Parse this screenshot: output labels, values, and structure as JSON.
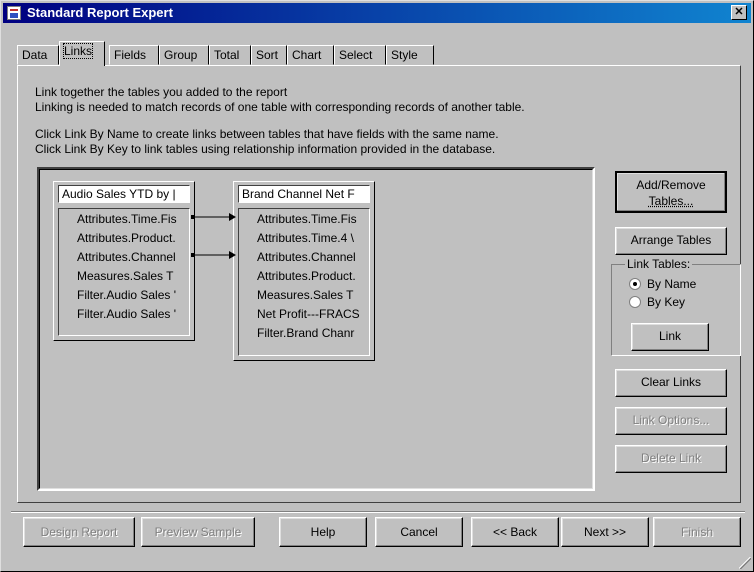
{
  "window": {
    "title": "Standard Report Expert",
    "close_label": "✕",
    "icon": "report-app-icon"
  },
  "tabs": [
    {
      "label": "Data"
    },
    {
      "label": "Links",
      "active": true
    },
    {
      "label": "Fields"
    },
    {
      "label": "Group"
    },
    {
      "label": "Total"
    },
    {
      "label": "Sort"
    },
    {
      "label": "Chart"
    },
    {
      "label": "Select"
    },
    {
      "label": "Style"
    }
  ],
  "instructions": {
    "line1": "Link together the tables you added to the report",
    "line2": "Linking is needed to match records of one table with corresponding records of another table.",
    "line3": "Click Link By Name to create links between tables that have fields with the same name.",
    "line4": "Click Link By Key to link tables using relationship information provided in the database."
  },
  "tables": {
    "left": {
      "title": "Audio Sales YTD by |",
      "fields": [
        "Attributes.Time.Fis",
        "Attributes.Product.",
        "Attributes.Channel",
        "Measures.Sales T",
        "Filter.Audio Sales '",
        "Filter.Audio Sales '"
      ]
    },
    "right": {
      "title": "Brand Channel Net F",
      "fields": [
        "Attributes.Time.Fis",
        "Attributes.Time.4 \\",
        "Attributes.Channel",
        "Attributes.Product.",
        "Measures.Sales T",
        "Net Profit---FRACS",
        "Filter.Brand Chanr"
      ]
    }
  },
  "links": [
    {
      "from_field": "Attributes.Time.Fis",
      "to_field": "Attributes.Time.Fis"
    },
    {
      "from_field": "Attributes.Channel",
      "to_field": "Attributes.Channel"
    }
  ],
  "side": {
    "add_remove_line1": "Add/Remove",
    "add_remove_line2": "Tables...",
    "arrange": "Arrange Tables",
    "link_tables_label": "Link Tables:",
    "by_name": "By Name",
    "by_key": "By Key",
    "selected": "By Name",
    "link": "Link",
    "clear_links": "Clear Links",
    "link_options": "Link Options...",
    "delete_link": "Delete Link"
  },
  "bottom": {
    "design_report": "Design Report",
    "preview_sample": "Preview Sample",
    "help": "Help",
    "cancel": "Cancel",
    "back": "<< Back",
    "next": "Next >>",
    "finish": "Finish"
  }
}
